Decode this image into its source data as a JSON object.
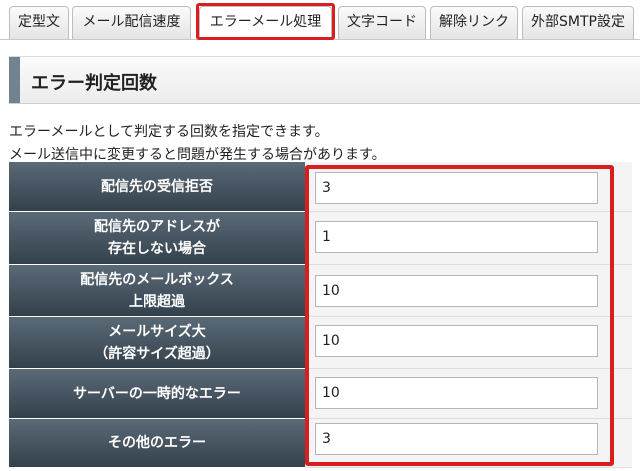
{
  "tabs": [
    {
      "label": "定型文",
      "active": false
    },
    {
      "label": "メール配信速度",
      "active": false
    },
    {
      "label": "エラーメール処理",
      "active": true
    },
    {
      "label": "文字コード",
      "active": false
    },
    {
      "label": "解除リンク",
      "active": false
    },
    {
      "label": "外部SMTP設定",
      "active": false
    }
  ],
  "section": {
    "title": "エラー判定回数"
  },
  "description": {
    "line1": "エラーメールとして判定する回数を指定できます。",
    "line2": "メール送信中に変更すると問題が発生する場合があります。"
  },
  "settings": [
    {
      "label": "配信先の受信拒否",
      "value": "3"
    },
    {
      "label": "配信先のアドレスが\n存在しない場合",
      "value": "1"
    },
    {
      "label": "配信先のメールボックス\n上限超過",
      "value": "10"
    },
    {
      "label": "メールサイズ大\n（許容サイズ超過）",
      "value": "10"
    },
    {
      "label": "サーバーの一時的なエラー",
      "value": "10"
    },
    {
      "label": "その他のエラー",
      "value": "3"
    }
  ],
  "colors": {
    "highlight": "#d81e1e",
    "label_bg": "#3f4d58",
    "section_bar": "#6f8391"
  }
}
